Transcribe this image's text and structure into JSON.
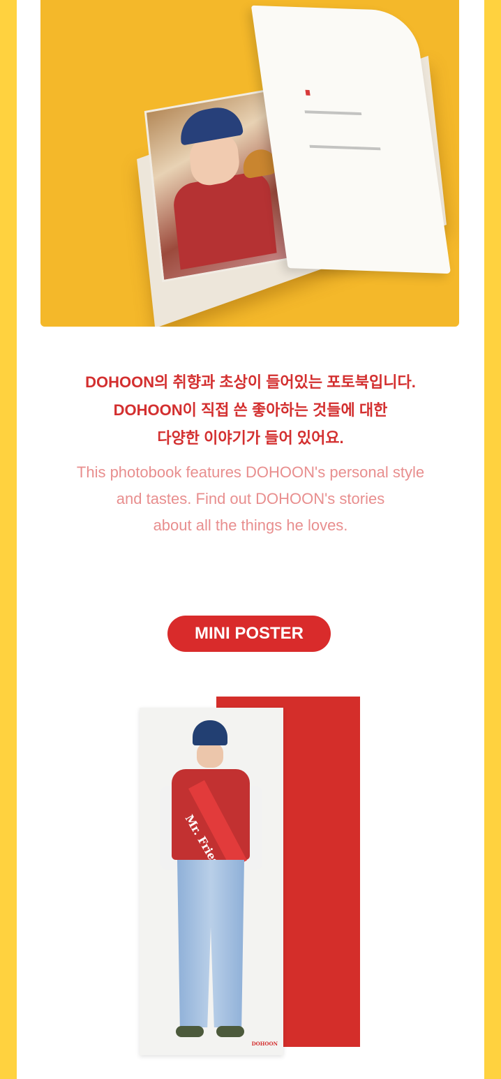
{
  "photobook": {
    "image_alt": "photobook-sample"
  },
  "description": {
    "korean_lines": [
      "DOHOON의 취향과 초상이 들어있는 포토북입니다.",
      "DOHOON이 직접 쓴 좋아하는 것들에 대한",
      "다양한 이야기가 들어 있어요."
    ],
    "english_lines": [
      "This photobook features DOHOON's personal style",
      "and tastes. Find out DOHOON's stories",
      "about all the things he loves."
    ]
  },
  "mini_poster": {
    "section_label": "MINI POSTER",
    "sash_text": "Mr. Fries",
    "logo_text": "DOHOON"
  },
  "colors": {
    "background_yellow": "#FFD23F",
    "accent_red": "#D92B2B",
    "light_red_text": "#E88E8E"
  }
}
